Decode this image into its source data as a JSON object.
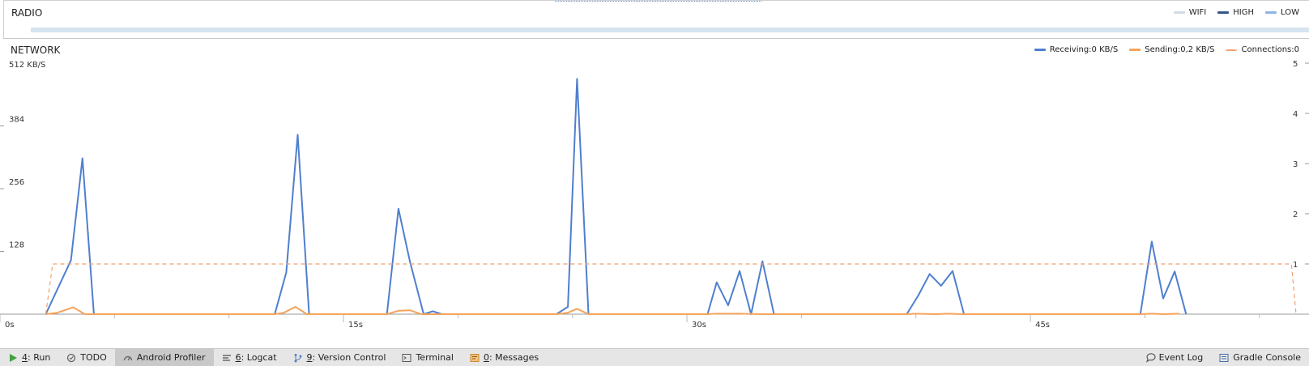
{
  "radio": {
    "title": "RADIO",
    "legend": [
      {
        "label": "WIFI",
        "color": "#d3dbe6"
      },
      {
        "label": "HIGH",
        "color": "#35558c"
      },
      {
        "label": "LOW",
        "color": "#8fb3e8"
      }
    ]
  },
  "network": {
    "title": "NETWORK",
    "legend": [
      {
        "label": "Receiving:0 KB/S",
        "color": "#4f7fcf"
      },
      {
        "label": "Sending:0,2 KB/S",
        "color": "#f5a35b"
      },
      {
        "label": "Connections:0",
        "color": "#f0a070",
        "dashed": true
      }
    ]
  },
  "chart_data": {
    "type": "line",
    "x_unit": "s",
    "x_ticks": [
      "0s",
      "15s",
      "30s",
      "45s"
    ],
    "xlim": [
      0,
      56.6
    ],
    "y_left": {
      "label": "512 KB/S",
      "ticks": [
        "384",
        "256",
        "128"
      ],
      "lim": [
        0,
        512
      ]
    },
    "y_right": {
      "ticks": [
        "5",
        "4",
        "3",
        "2",
        "1"
      ],
      "lim": [
        0,
        5
      ]
    },
    "series": [
      {
        "name": "Receiving",
        "axis": "left",
        "color": "#4f7fcf",
        "x": [
          2.0,
          3.1,
          3.6,
          4.1,
          12.0,
          12.5,
          13.0,
          13.5,
          16.9,
          17.4,
          17.9,
          18.5,
          18.9,
          19.3,
          19.7,
          24.3,
          24.8,
          25.2,
          25.7,
          30.9,
          31.3,
          31.8,
          32.3,
          32.8,
          33.3,
          33.8,
          39.6,
          40.1,
          40.6,
          41.1,
          41.6,
          42.1,
          49.8,
          50.3,
          50.8,
          51.3,
          51.8
        ],
        "y": [
          0,
          110,
          318,
          0,
          0,
          85,
          366,
          0,
          0,
          215,
          108,
          0,
          6,
          0,
          0,
          0,
          15,
          480,
          0,
          0,
          65,
          18,
          88,
          0,
          108,
          0,
          0,
          38,
          82,
          58,
          88,
          0,
          0,
          148,
          32,
          87,
          0
        ]
      },
      {
        "name": "Sending",
        "axis": "left",
        "color": "#f5a35b",
        "x": [
          2.0,
          2.5,
          3.2,
          3.7,
          12.0,
          12.4,
          12.9,
          13.4,
          16.9,
          17.4,
          17.9,
          18.4,
          24.3,
          24.8,
          25.2,
          25.7,
          30.8,
          31.3,
          32.3,
          33.3,
          39.6,
          40.0,
          40.9,
          41.4,
          42.0,
          49.8,
          50.3,
          50.8,
          51.5
        ],
        "y": [
          0,
          3,
          14,
          0,
          0,
          3,
          15,
          0,
          0,
          7,
          8,
          0,
          0,
          3,
          11,
          0,
          0,
          1,
          1,
          0,
          0,
          1,
          0,
          1,
          0,
          0,
          1,
          0,
          1
        ]
      },
      {
        "name": "Connections",
        "axis": "right",
        "color": "#f0a070",
        "dashed": true,
        "x": [
          2.0,
          2.3,
          56.4,
          56.6
        ],
        "y": [
          0,
          1,
          1,
          0
        ]
      }
    ]
  },
  "statusbar": {
    "left": [
      {
        "num": "4",
        "label": ": Run",
        "icon": "run-icon"
      },
      {
        "num": "",
        "label": "TODO",
        "icon": "todo-icon"
      },
      {
        "num": "",
        "label": "Android Profiler",
        "icon": "profiler-icon",
        "active": true
      },
      {
        "num": "6",
        "label": ": Logcat",
        "icon": "logcat-icon"
      },
      {
        "num": "9",
        "label": ": Version Control",
        "icon": "version-control-icon"
      },
      {
        "num": "",
        "label": "Terminal",
        "icon": "terminal-icon"
      },
      {
        "num": "0",
        "label": ": Messages",
        "icon": "messages-icon"
      }
    ],
    "right": [
      {
        "label": "Event Log",
        "icon": "event-log-icon"
      },
      {
        "label": "Gradle Console",
        "icon": "gradle-console-icon"
      }
    ]
  }
}
